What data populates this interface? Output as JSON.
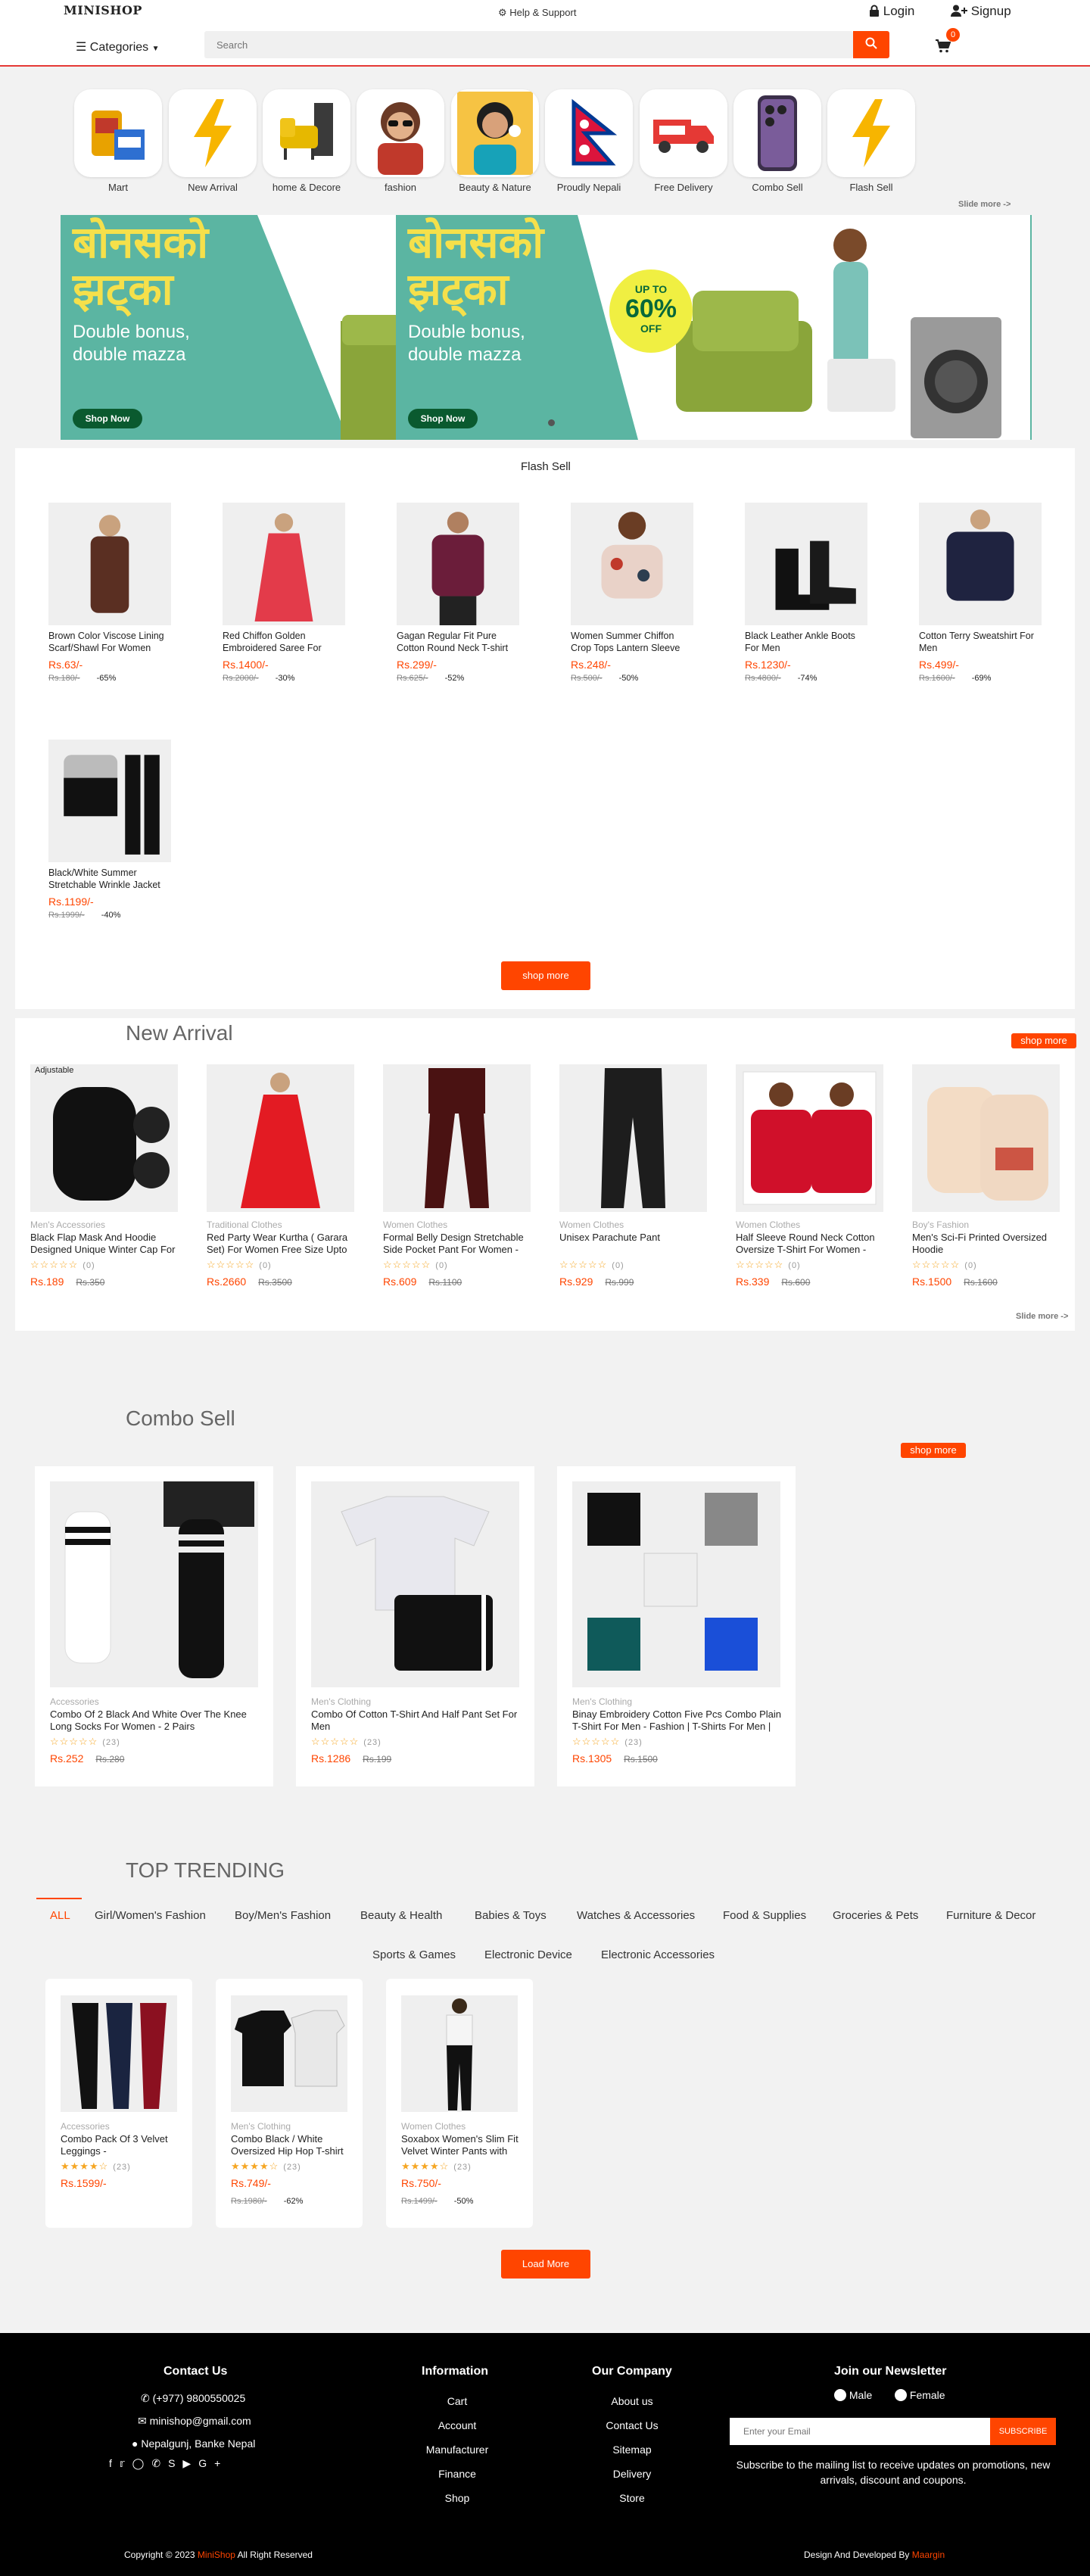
{
  "header": {
    "logo": "MINISHOP",
    "help": "Help & Support",
    "login": "Login",
    "signup": "Signup",
    "categories": "Categories",
    "search_placeholder": "Search",
    "cart_count": "0"
  },
  "categories": [
    {
      "label": "Mart",
      "icon": "grocery"
    },
    {
      "label": "New Arrival",
      "icon": "lightning"
    },
    {
      "label": "home & Decore",
      "icon": "sofa"
    },
    {
      "label": "fashion",
      "icon": "woman-sunglasses"
    },
    {
      "label": "Beauty & Nature",
      "icon": "woman-beauty"
    },
    {
      "label": "Proudly Nepali",
      "icon": "nepal-flag"
    },
    {
      "label": "Free Delivery",
      "icon": "delivery-truck"
    },
    {
      "label": "Combo Sell",
      "icon": "phone"
    },
    {
      "label": "Flash Sell",
      "icon": "lightning"
    }
  ],
  "slide_more": "Slide more ->",
  "banner": {
    "heading_line1": "बोनसको",
    "heading_line2": "झट्का",
    "sub_line1": "Double bonus,",
    "sub_line2": "double mazza",
    "badge_top": "UP TO",
    "badge_value": "60%",
    "badge_bottom": "OFF",
    "button": "Shop Now"
  },
  "flash": {
    "title": "Flash Sell",
    "button": "shop more",
    "items": [
      {
        "name": "Brown Color Viscose Lining Scarf/Shawl For Women",
        "price": "Rs.63/-",
        "old": "Rs.180/-",
        "off": "-65%"
      },
      {
        "name": "Red Chiffon Golden Embroidered Saree For",
        "price": "Rs.1400/-",
        "old": "Rs.2000/-",
        "off": "-30%"
      },
      {
        "name": "Gagan Regular Fit Pure Cotton Round Neck T-shirt",
        "price": "Rs.299/-",
        "old": "Rs.625/-",
        "off": "-52%"
      },
      {
        "name": "Women Summer Chiffon Crop Tops Lantern Sleeve",
        "price": "Rs.248/-",
        "old": "Rs.500/-",
        "off": "-50%"
      },
      {
        "name": "Black Leather Ankle Boots For Men",
        "price": "Rs.1230/-",
        "old": "Rs.4800/-",
        "off": "-74%"
      },
      {
        "name": "Cotton Terry Sweatshirt For Men",
        "price": "Rs.499/-",
        "old": "Rs.1600/-",
        "off": "-69%"
      },
      {
        "name": "Black/White Summer Stretchable Wrinkle Jacket",
        "price": "Rs.1199/-",
        "old": "Rs.1999/-",
        "off": "-40%"
      }
    ]
  },
  "new_arrival": {
    "title": "New Arrival",
    "button": "shop more",
    "slide_more": "Slide more ->",
    "items": [
      {
        "cat": "Men's Accessories",
        "name": "Black Flap Mask And Hoodie Designed Unique Winter Cap For",
        "reviews": "(0)",
        "price": "Rs.189",
        "old": "Rs.350",
        "img_label": "Adjustable"
      },
      {
        "cat": "Traditional Clothes",
        "name": "Red Party Wear Kurtha ( Garara Set) For Women Free Size Upto",
        "reviews": "(0)",
        "price": "Rs.2660",
        "old": "Rs.3500"
      },
      {
        "cat": "Women Clothes",
        "name": "Formal Belly Design Stretchable Side Pocket Pant For Women -",
        "reviews": "(0)",
        "price": "Rs.609",
        "old": "Rs.1100"
      },
      {
        "cat": "Women Clothes",
        "name": "Unisex Parachute Pant",
        "reviews": "(0)",
        "price": "Rs.929",
        "old": "Rs.999"
      },
      {
        "cat": "Women Clothes",
        "name": "Half Sleeve Round Neck Cotton Oversize T-Shirt For Women -",
        "reviews": "(0)",
        "price": "Rs.339",
        "old": "Rs.600"
      },
      {
        "cat": "Boy's Fashion",
        "name": "Men's Sci-Fi Printed Oversized Hoodie",
        "reviews": "(0)",
        "price": "Rs.1500",
        "old": "Rs.1600"
      }
    ]
  },
  "combo": {
    "title": "Combo Sell",
    "button": "shop more",
    "items": [
      {
        "cat": "Accessories",
        "name": "Combo Of 2 Black And White Over The Knee Long Socks For Women - 2 Pairs",
        "reviews": "(23)",
        "price": "Rs.252",
        "old": "Rs.280"
      },
      {
        "cat": "Men's Clothing",
        "name": "Combo Of Cotton T-Shirt And Half Pant Set For Men",
        "reviews": "(23)",
        "price": "Rs.1286",
        "old": "Rs.199"
      },
      {
        "cat": "Men's Clothing",
        "name": "Binay Embroidery Cotton Five Pcs Combo Plain T-Shirt For Men - Fashion | T-Shirts For Men |",
        "reviews": "(23)",
        "price": "Rs.1305",
        "old": "Rs.1500"
      }
    ]
  },
  "trending": {
    "title": "TOP TRENDING",
    "tabs": [
      "ALL",
      "Girl/Women's Fashion",
      "Boy/Men's Fashion",
      "Beauty & Health",
      "Babies & Toys",
      "Watches & Accessories",
      "Food & Supplies",
      "Groceries & Pets",
      "Furniture & Decor",
      "Sports & Games",
      "Electronic Device",
      "Electronic Accessories"
    ],
    "button": "Load More",
    "items": [
      {
        "cat": "Accessories",
        "name": "Combo Pack Of 3 Velvet Leggings -",
        "reviews": "(23)",
        "price": "Rs.1599/-",
        "old": "",
        "off": ""
      },
      {
        "cat": "Men's Clothing",
        "name": "Combo Black / White Oversized Hip Hop T-shirt",
        "reviews": "(23)",
        "price": "Rs.749/-",
        "old": "Rs.1980/-",
        "off": "-62%"
      },
      {
        "cat": "Women Clothes",
        "name": "Soxabox Women's Slim Fit Velvet Winter Pants with",
        "reviews": "(23)",
        "price": "Rs.750/-",
        "old": "Rs.1499/-",
        "off": "-50%"
      }
    ]
  },
  "footer": {
    "contact_title": "Contact Us",
    "phone": "(+977) 9800550025",
    "email": "minishop@gmail.com",
    "address": "Nepalgunj, Banke Nepal",
    "info_title": "Information",
    "info_links": [
      "Cart",
      "Account",
      "Manufacturer",
      "Finance",
      "Shop"
    ],
    "company_title": "Our Company",
    "company_links": [
      "About us",
      "Contact Us",
      "Sitemap",
      "Delivery",
      "Store"
    ],
    "newsletter_title": "Join our Newsletter",
    "male": "Male",
    "female": "Female",
    "email_placeholder": "Enter your Email",
    "subscribe": "SUBSCRIBE",
    "newsletter_text": "Subscribe to the mailing list to receive updates on promotions, new arrivals, discount and coupons.",
    "copyright_prefix": "Copyright © 2023",
    "copyright_brand": "MiniShop",
    "copyright_suffix": "All Right Reserved",
    "design_prefix": "Design And Developed By",
    "design_brand": "Maargin"
  },
  "colors": {
    "accent": "#ff4500",
    "banner_bg": "#5bb5a2"
  }
}
